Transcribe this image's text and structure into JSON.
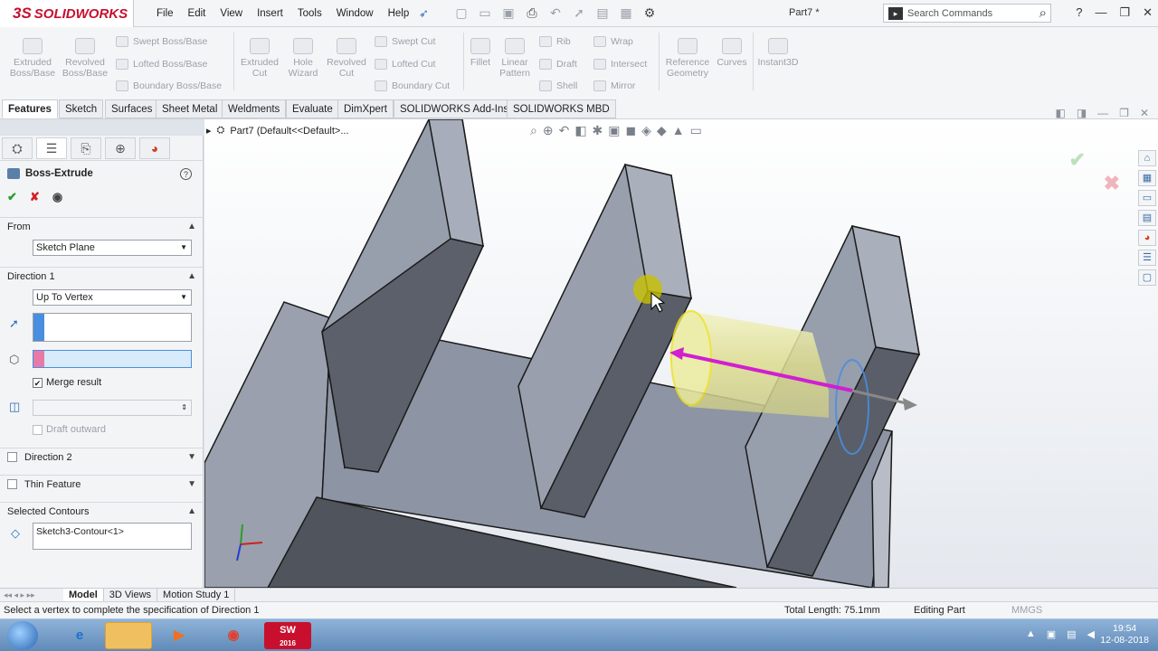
{
  "app": {
    "brand": "SOLIDWORKS",
    "brand_prefix": "3S",
    "document_title": "Part7 *"
  },
  "menus": [
    "File",
    "Edit",
    "View",
    "Insert",
    "Tools",
    "Window",
    "Help"
  ],
  "search": {
    "placeholder": "Search Commands"
  },
  "commands": {
    "extruded_boss": "Extruded Boss/Base",
    "revolved_boss": "Revolved Boss/Base",
    "swept_boss": "Swept Boss/Base",
    "lofted_boss": "Lofted Boss/Base",
    "boundary_boss": "Boundary Boss/Base",
    "extruded_cut": "Extruded Cut",
    "hole_wizard": "Hole Wizard",
    "revolved_cut": "Revolved Cut",
    "swept_cut": "Swept Cut",
    "lofted_cut": "Lofted Cut",
    "boundary_cut": "Boundary Cut",
    "fillet": "Fillet",
    "linear_pattern": "Linear Pattern",
    "rib": "Rib",
    "draft": "Draft",
    "shell": "Shell",
    "wrap": "Wrap",
    "intersect": "Intersect",
    "mirror": "Mirror",
    "reference_geometry": "Reference Geometry",
    "curves": "Curves",
    "instant3d": "Instant3D"
  },
  "tabs": [
    "Features",
    "Sketch",
    "Surfaces",
    "Sheet Metal",
    "Weldments",
    "Evaluate",
    "DimXpert",
    "SOLIDWORKS Add-Ins",
    "SOLIDWORKS MBD"
  ],
  "panel": {
    "title": "Boss-Extrude",
    "from_label": "From",
    "from_value": "Sketch Plane",
    "direction1_label": "Direction 1",
    "direction1_value": "Up To Vertex",
    "merge_result": "Merge result",
    "draft_outward": "Draft outward",
    "direction2_label": "Direction 2",
    "thin_feature_label": "Thin Feature",
    "selected_contours_label": "Selected Contours",
    "contour_value": "Sketch3-Contour<1>"
  },
  "viewport": {
    "breadcrumb": "Part7  (Default<<Default>..."
  },
  "bottom_tabs": [
    "Model",
    "3D Views",
    "Motion Study 1"
  ],
  "status": {
    "message": "Select a vertex to complete the specification of Direction 1",
    "total_length": "Total Length: 75.1mm",
    "mode": "Editing Part",
    "units": "MMGS"
  },
  "taskbar": {
    "time": "19:54",
    "date": "12-08-2018",
    "sw_badge": "2016"
  },
  "colors": {
    "accent": "#c8102e",
    "part_face": "#8f96a6",
    "extrude_arrow": "#d01fd0",
    "preview": "#e8e89a"
  }
}
